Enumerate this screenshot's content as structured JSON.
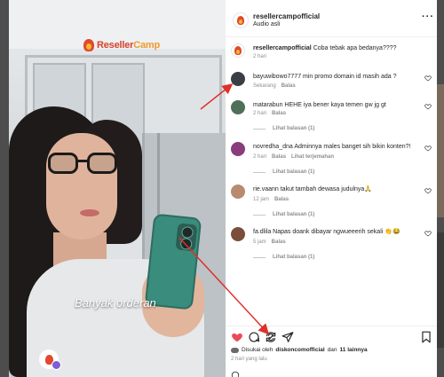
{
  "video": {
    "brand_part1": "Reseller",
    "brand_part2": "Camp",
    "caption": "Banyak orderan"
  },
  "header": {
    "username": "resellercampofficial",
    "audio": "Audio asli",
    "more_label": "···"
  },
  "post_caption": {
    "username": "resellercampofficial",
    "text": "Coba tebak apa bedanya????",
    "time": "2 hari"
  },
  "comments": [
    {
      "text": "bayuwibowo7777 min promo domain id masih ada ?",
      "time": "Sekarang",
      "reply": "Balas"
    },
    {
      "text": "matarabun HEHE iya bener kaya temen gw jg gt",
      "time": "2 hari",
      "reply": "Balas",
      "view_replies": "Lihat balasan (1)"
    },
    {
      "text": "novredha_dna Adminnya males banget sih bikin konten?!",
      "time": "2 hari",
      "reply": "Balas",
      "translate": "Lihat terjemahan",
      "view_replies": "Lihat balasan (1)"
    },
    {
      "text": "rie.vaann takut tambah dewasa judulnya🙏",
      "time": "12 jam",
      "reply": "Balas",
      "view_replies": "Lihat balasan (1)"
    },
    {
      "text": "fa.dlila Napas doank dibayar ngwueeerih sekali 👏😂",
      "time": "5 jam",
      "reply": "Balas",
      "view_replies": "Lihat balasan (1)"
    }
  ],
  "likes": {
    "prefix": "Disukai oleh",
    "user": "diskoncomofficial",
    "joiner": "dan",
    "others": "11 lainnya"
  },
  "posted_ago": "2 hari yang lalu",
  "colors": {
    "heart_liked": "#ed4956",
    "annotation": "#e0302a",
    "muted": "#8e8e8e"
  }
}
